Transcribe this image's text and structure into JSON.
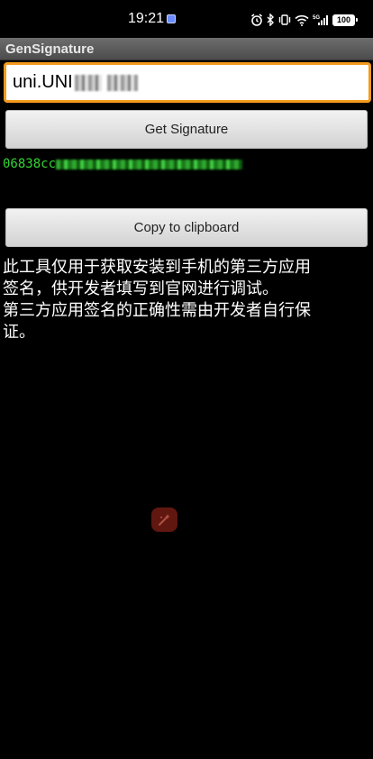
{
  "status_bar": {
    "time": "19:21",
    "battery": "100",
    "icons": [
      "app-notification-icon",
      "alarm-icon",
      "bluetooth-icon",
      "vibrate-icon",
      "wifi-icon",
      "cellular-5g-icon",
      "battery-icon"
    ]
  },
  "app": {
    "title": "GenSignature"
  },
  "package_input": {
    "value_visible": "uni.UNI"
  },
  "buttons": {
    "get_signature": "Get Signature",
    "copy_to_clipboard": "Copy to clipboard"
  },
  "signature": {
    "visible_prefix": "06838cc"
  },
  "info": {
    "lines": [
      "此工具仅用于获取安装到手机的第三方应用",
      "签名，供开发者填写到官网进行调试。",
      "第三方应用签名的正确性需由开发者自行保",
      "证。"
    ]
  },
  "colors": {
    "input_focus_border": "#f39a1c",
    "signature_text": "#33d633",
    "background": "#000000"
  }
}
